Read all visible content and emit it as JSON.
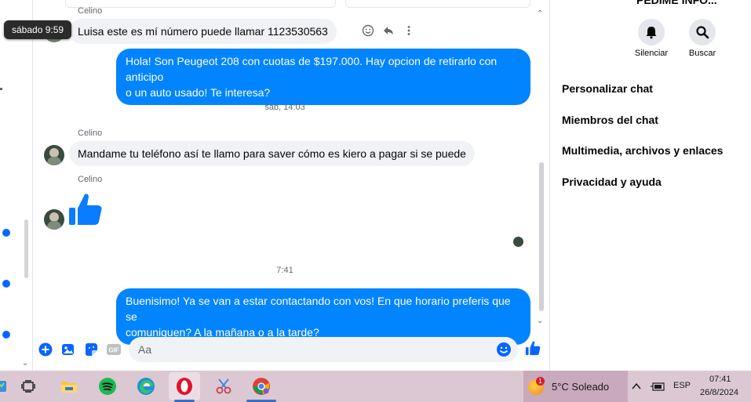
{
  "tooltip": {
    "text": "sábado 9:59"
  },
  "chat": {
    "messages": [
      {
        "type": "in",
        "sender": "Celino",
        "text": "Luisa este es mí número puede llamar 1123530563"
      },
      {
        "type": "out",
        "line1": "Hola! Son Peugeot 208 con cuotas de $197.000. Hay opcion de retirarlo con anticipo",
        "line2": "o un auto usado!  Te interesa?"
      },
      {
        "type": "stamp",
        "text": "sáb, 14:03"
      },
      {
        "type": "in",
        "sender": "Celino",
        "text": "Mandame tu teléfono así te llamo para saver cómo es kiero a pagar si se puede"
      },
      {
        "type": "thumb",
        "sender": "Celino"
      },
      {
        "type": "stamp",
        "text": "7:41"
      },
      {
        "type": "out",
        "line1": "Buenisimo! Ya se van a estar contactando con vos! En que horario preferis que se",
        "line2": "comuniquen? A la mañana o a la tarde?"
      }
    ],
    "composer": {
      "placeholder": "Aa"
    }
  },
  "right_panel": {
    "header": "PEDIME INFO...",
    "buttons": [
      {
        "label": "Silenciar",
        "icon": "bell-icon"
      },
      {
        "label": "Buscar",
        "icon": "search-icon"
      }
    ],
    "menu": [
      "Personalizar chat",
      "Miembros del chat",
      "Multimedia, archivos y enlaces",
      "Privacidad y ayuda"
    ]
  },
  "taskbar": {
    "weather": {
      "badge": "1",
      "text": "5°C  Soleado"
    },
    "language": "ESP",
    "time": "07:41",
    "date": "26/8/2024"
  },
  "colors": {
    "accent": "#0084ff",
    "incoming_bubble": "#f0f2f5",
    "taskbar": "#dcc8d3"
  }
}
